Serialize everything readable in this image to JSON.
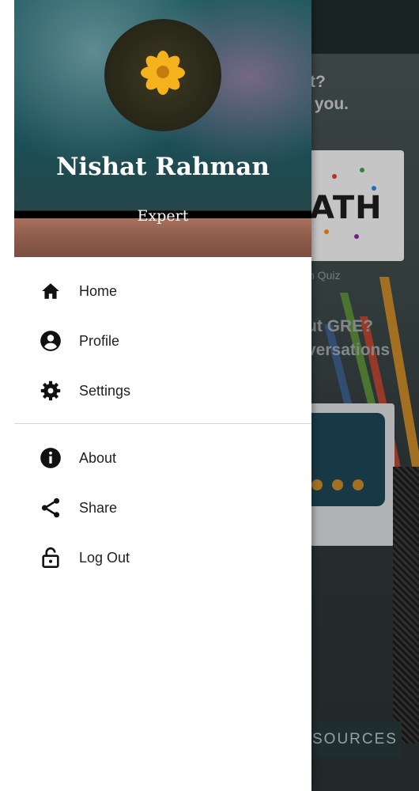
{
  "drawer": {
    "user_name": "Nishat Rahman",
    "user_role": "Expert",
    "menu_primary": [
      {
        "label": "Home",
        "icon": "home-icon"
      },
      {
        "label": "Profile",
        "icon": "account-circle-icon"
      },
      {
        "label": "Settings",
        "icon": "gear-icon"
      }
    ],
    "menu_secondary": [
      {
        "label": "About",
        "icon": "info-icon"
      },
      {
        "label": "Share",
        "icon": "share-icon"
      },
      {
        "label": "Log Out",
        "icon": "lock-open-icon"
      }
    ]
  },
  "background_app": {
    "heading1": "t?\n you.",
    "card1_text": "ATH",
    "card1_caption": "h Quiz",
    "heading2": "ut GRE?\nversations",
    "button_label": "SOURCES"
  },
  "colors": {
    "drawer_bg": "#ffffff",
    "icon": "#111111",
    "label": "#1f1f1f"
  }
}
